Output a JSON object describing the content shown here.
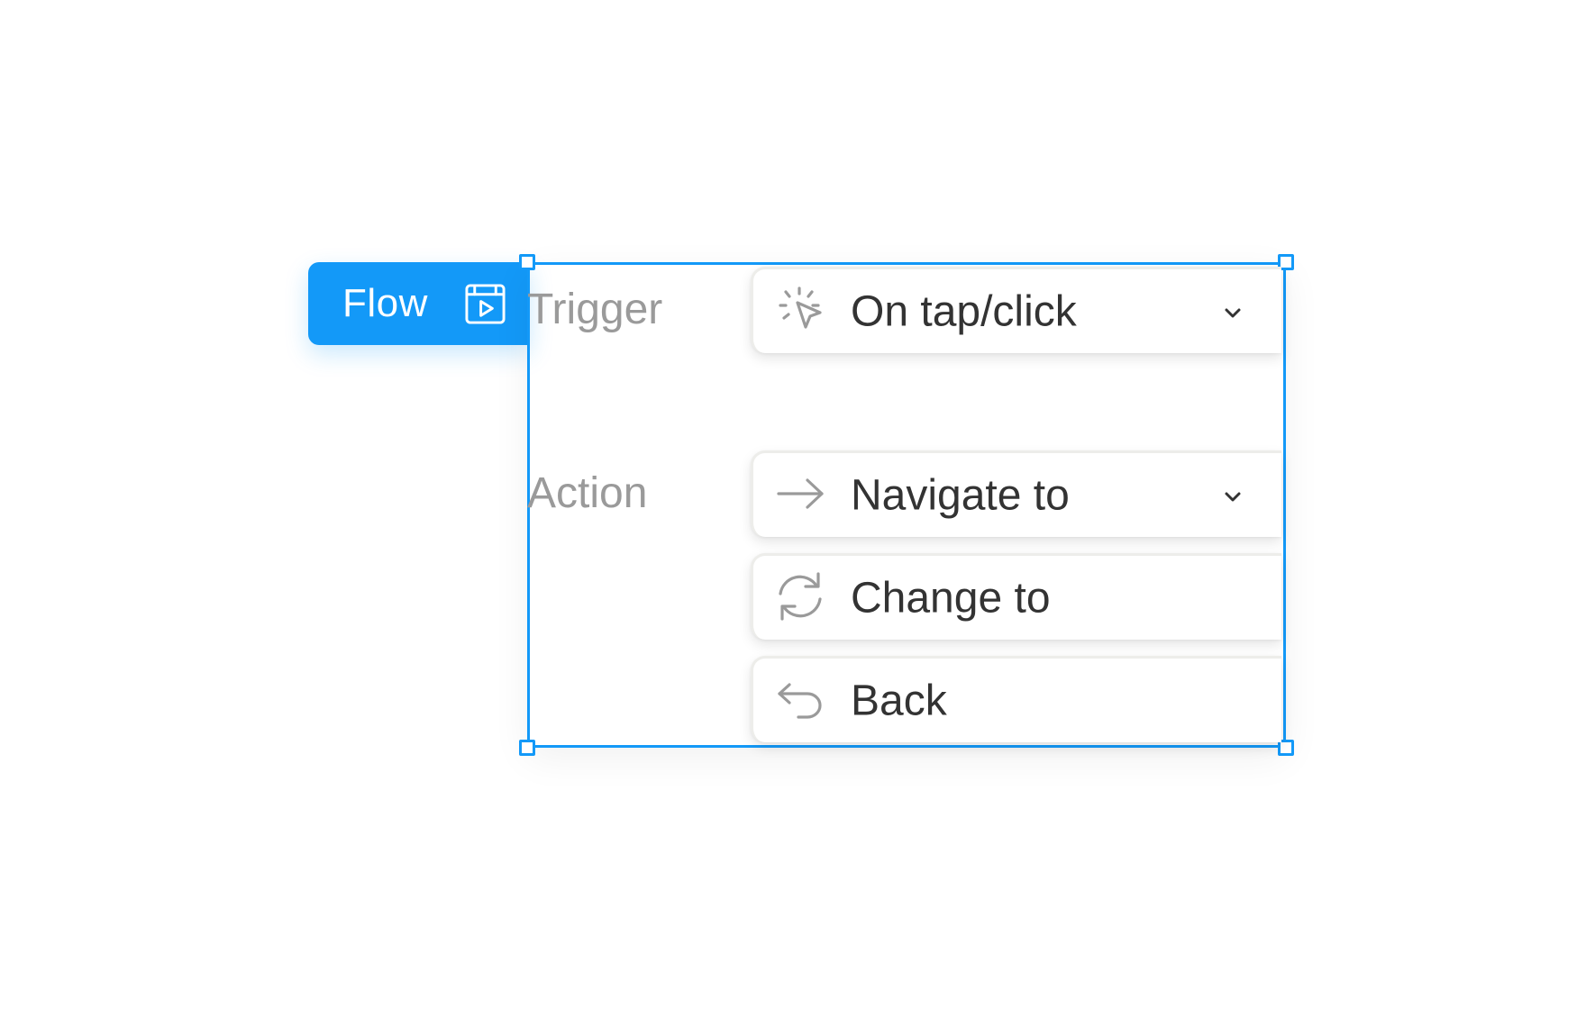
{
  "flow_tag": {
    "label": "Flow",
    "icon": "play-window-icon"
  },
  "trigger": {
    "label": "Trigger",
    "selected": {
      "label": "On tap/click",
      "icon": "tap-click-cursor-icon"
    }
  },
  "action": {
    "label": "Action",
    "selected": {
      "label": "Navigate to",
      "icon": "arrow-right-icon"
    },
    "options": [
      {
        "label": "Change to",
        "icon": "refresh-arrows-icon"
      },
      {
        "label": "Back",
        "icon": "return-arrow-icon"
      }
    ]
  },
  "colors": {
    "accent": "#1399f8",
    "label_gray": "#9a9a9a",
    "text_dark": "#333333",
    "icon_gray": "#9a9a9a",
    "background": "#ffffff"
  }
}
